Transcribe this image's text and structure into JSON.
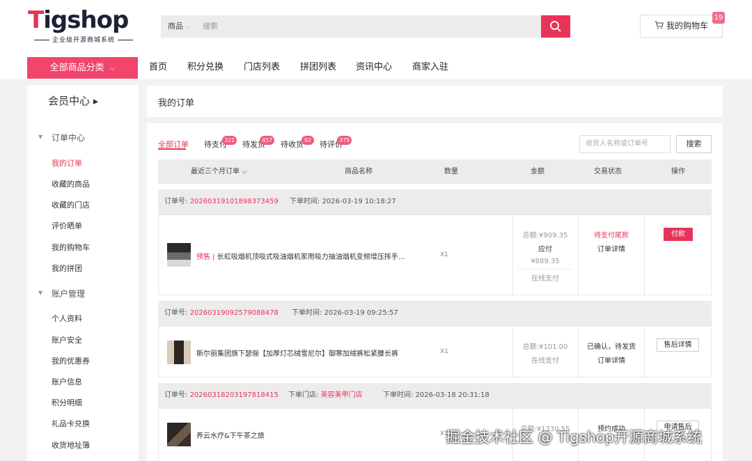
{
  "logo": {
    "text_t": "T",
    "text_rest": "igshop",
    "subtitle": "企业级开源商城系统"
  },
  "search": {
    "category": "商品",
    "placeholder": "搜索"
  },
  "cart": {
    "label": "我的购物车",
    "count": "19"
  },
  "nav": {
    "all_label": "全部商品分类",
    "items": [
      "首页",
      "积分兑换",
      "门店列表",
      "拼团列表",
      "资讯中心",
      "商家入驻"
    ]
  },
  "sidebar": {
    "member_title": "会员中心 ▸",
    "sections": [
      {
        "title": "订单中心",
        "links": [
          "我的订单",
          "收藏的商品",
          "收藏的门店",
          "评价晒单",
          "我的购物车",
          "我的拼团"
        ]
      },
      {
        "title": "账户管理",
        "links": [
          "个人资料",
          "账户安全",
          "我的优惠券",
          "账户信息",
          "积分明细",
          "礼品卡兑换",
          "收货地址簿"
        ]
      }
    ]
  },
  "page_title": "我的订单",
  "tabs": [
    {
      "label": "全部订单",
      "badge": ""
    },
    {
      "label": "待支付",
      "badge": "321"
    },
    {
      "label": "待发货",
      "badge": "457"
    },
    {
      "label": "待收货",
      "badge": "92"
    },
    {
      "label": "待评价",
      "badge": "375"
    }
  ],
  "filter": {
    "placeholder": "收货人名称或订单号",
    "button": "搜索"
  },
  "table_headers": [
    "最近三个月订单 ⌵",
    "商品名称",
    "数量",
    "金额",
    "交易状态",
    "操作"
  ],
  "orders": [
    {
      "no_label": "订单号:",
      "no": "20260319101898373459",
      "time_label": "下单时间:",
      "time": "2026-03-19 10:18:27",
      "product_prefix": "预售 | ",
      "product": "长虹吸烟机顶吸式吸油烟机家用吸力抽油烟机变频增压挥手...",
      "qty": "X1",
      "total": "总额:¥909.35",
      "due_label": "应付",
      "due": "¥889.35",
      "pay_method": "在线支付",
      "status": "待支付尾款",
      "detail": "订单详情",
      "action": "付款"
    },
    {
      "no_label": "订单号:",
      "no": "20260319092579088478",
      "time_label": "下单时间:",
      "time": "2026-03-19 09:25:57",
      "product": "斯尔丽集团旗下瑟俪【加厚灯芯绒雪尼尔】御寒加绒裤松紧腰长裤",
      "qty": "X1",
      "total": "总额:¥101.00",
      "pay_method": "在线支付",
      "status": "已确认，待发货",
      "detail": "订单详情",
      "action": "售后详情"
    },
    {
      "no_label": "订单号:",
      "no": "20260318203197818415",
      "store_label": "下单门店:",
      "store": "美容美甲门店",
      "time_label": "下单时间:",
      "time": "2026-03-18 20:31:18",
      "product": "养云水疗&下午茶之旅",
      "qty": "X1",
      "total": "总额:¥1330.55",
      "status": "预约成功",
      "action": "申请售后"
    }
  ],
  "watermark": "掘金技术社区 @ Tigshop开源商城系统",
  "colors": {
    "accent": "#e8345a",
    "nav_accent": "#f1456c",
    "badge": "#f05a7e"
  }
}
